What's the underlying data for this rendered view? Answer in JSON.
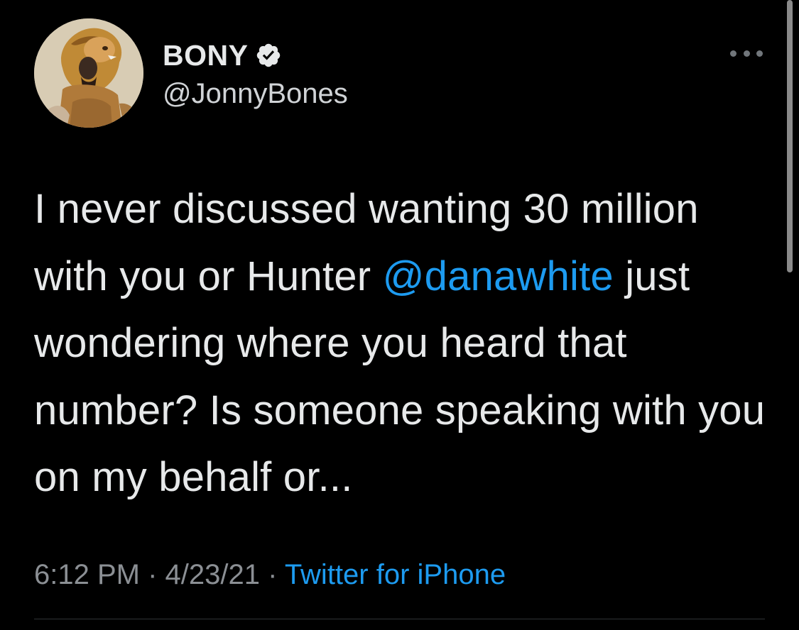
{
  "author": {
    "display_name": "BONY",
    "handle": "@JonnyBones",
    "verified": true,
    "avatar_icon": "lion-headdress-avatar"
  },
  "tweet": {
    "text_before": "I never discussed wanting 30 million with you or Hunter ",
    "mention": "@danawhite",
    "text_after": " just wondering where you heard that number? Is someone speaking with you on my behalf or..."
  },
  "meta": {
    "time": "6:12 PM",
    "separator": " · ",
    "date": "4/23/21",
    "source": "Twitter for iPhone"
  },
  "icons": {
    "more": "more-horizontal-icon",
    "verified": "verified-badge-icon"
  },
  "colors": {
    "background": "#000000",
    "text": "#e7e9ea",
    "secondary": "#8b8f94",
    "link": "#1d9bf0"
  }
}
